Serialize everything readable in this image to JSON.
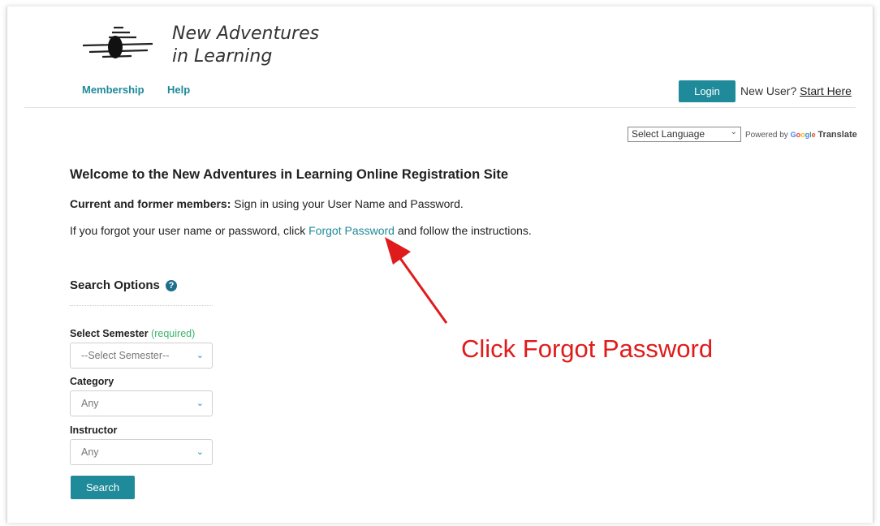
{
  "header": {
    "logo_line1": "New Adventures",
    "logo_line2": "in Learning",
    "nav": [
      "Membership",
      "Help"
    ],
    "login_label": "Login",
    "new_user_text": "New User?",
    "start_here_label": "Start Here"
  },
  "translate": {
    "select_label": "Select Language",
    "powered_by": "Powered by",
    "google": "Google",
    "translate": "Translate"
  },
  "main": {
    "welcome_title": "Welcome to the New Adventures in Learning Online Registration Site",
    "members_bold": "Current and former members:",
    "members_text": "Sign in using your User Name and Password.",
    "forgot_prefix": "If you forgot your user name or password, click",
    "forgot_link": "Forgot Password",
    "forgot_suffix": "and follow the instructions."
  },
  "search": {
    "title": "Search Options",
    "help_icon_glyph": "?",
    "semester_label": "Select Semester",
    "required_label": "(required)",
    "semester_value": "--Select Semester--",
    "category_label": "Category",
    "category_value": "Any",
    "instructor_label": "Instructor",
    "instructor_value": "Any",
    "button_label": "Search"
  },
  "annotation": {
    "text": "Click Forgot Password",
    "color": "#e01b1b"
  },
  "colors": {
    "accent": "#1f8a99",
    "required": "#3cb46a"
  }
}
